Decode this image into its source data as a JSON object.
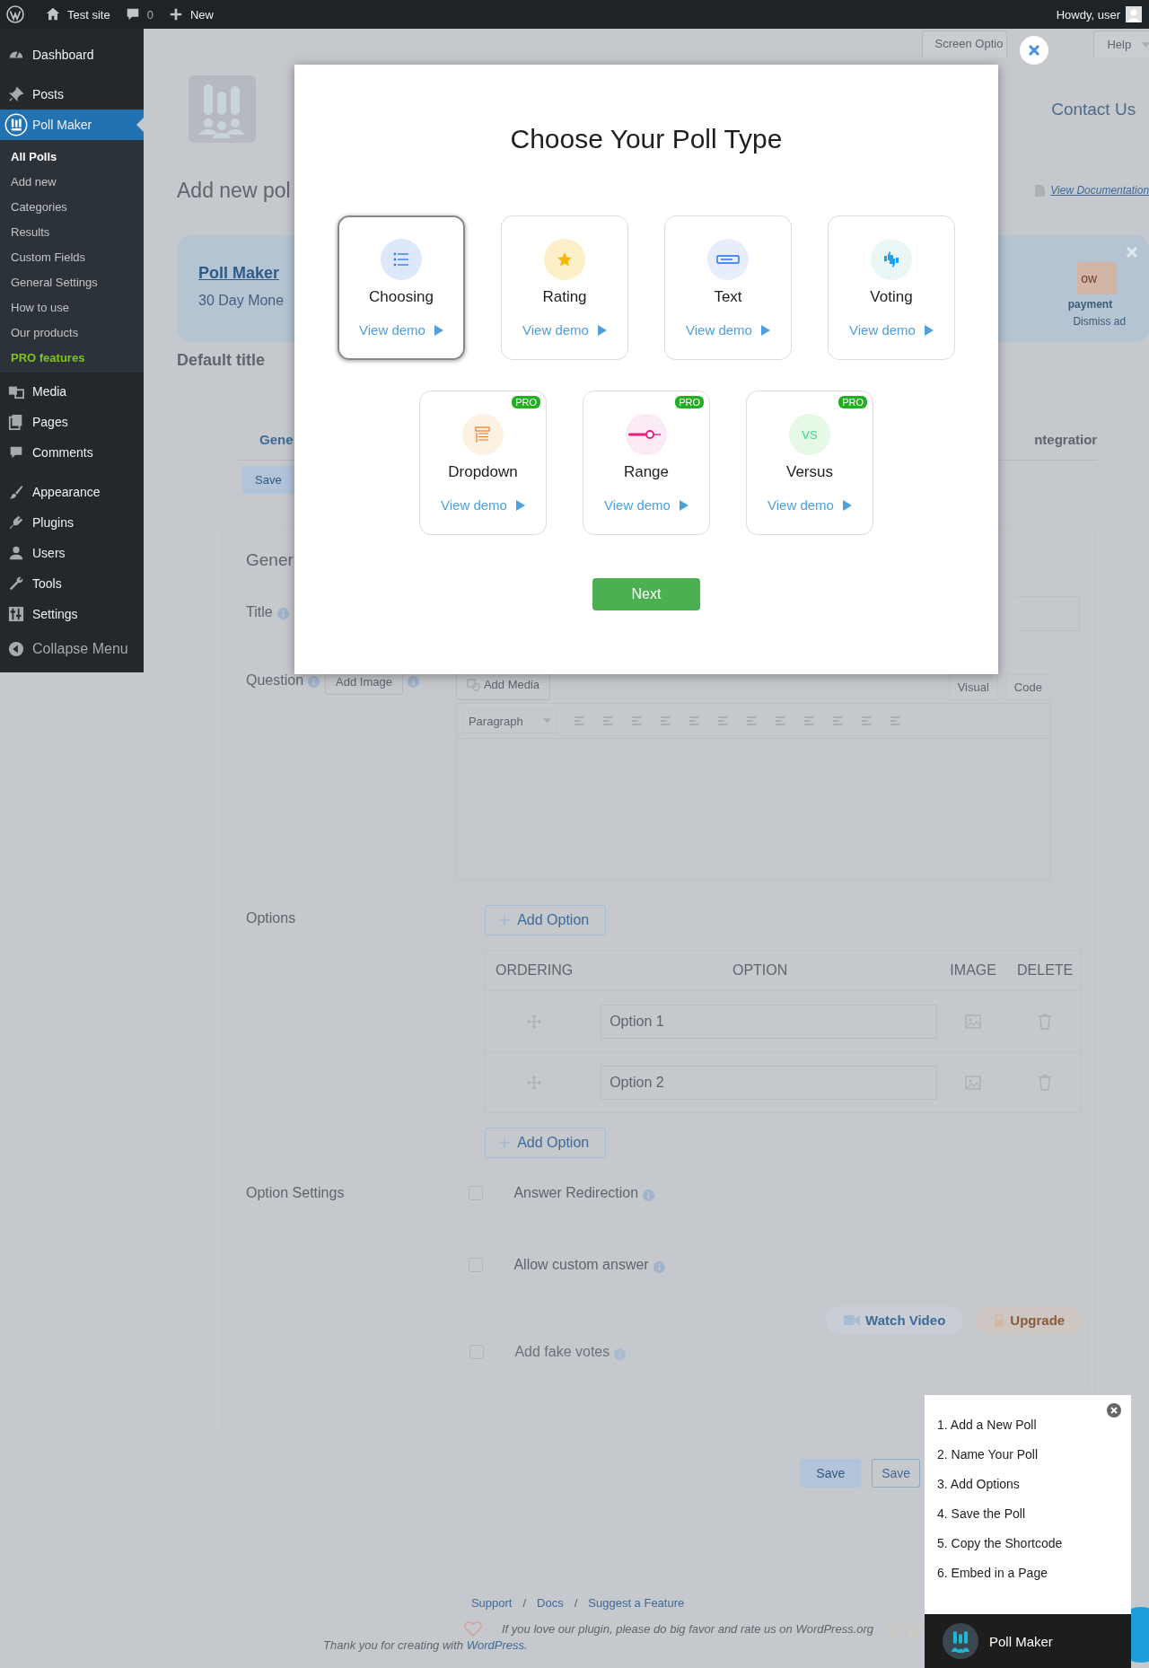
{
  "admin_bar": {
    "site": "Test site",
    "comments": "0",
    "new": "New",
    "greeting": "Howdy, user"
  },
  "sidebar": {
    "items": [
      {
        "label": "Dashboard",
        "selected": false
      },
      {
        "label": "Posts",
        "selected": false
      },
      {
        "label": "Poll Maker",
        "selected": true,
        "children": [
          {
            "label": "All Polls",
            "selected": true,
            "kind": "link"
          },
          {
            "label": "Add new",
            "selected": false,
            "kind": "link"
          },
          {
            "label": "Categories",
            "selected": false,
            "kind": "link"
          },
          {
            "label": "Results",
            "selected": false,
            "kind": "link"
          },
          {
            "label": "Custom Fields",
            "selected": false,
            "kind": "link"
          },
          {
            "label": "General Settings",
            "selected": false,
            "kind": "link"
          },
          {
            "label": "How to use",
            "selected": false,
            "kind": "link"
          },
          {
            "label": "Our products",
            "selected": false,
            "kind": "link"
          },
          {
            "label": "PRO features",
            "selected": false,
            "kind": "pro"
          }
        ]
      },
      {
        "label": "Media",
        "selected": false
      },
      {
        "label": "Pages",
        "selected": false
      },
      {
        "label": "Comments",
        "selected": false
      },
      {
        "label": "Appearance",
        "selected": false
      },
      {
        "label": "Plugins",
        "selected": false
      },
      {
        "label": "Users",
        "selected": false
      },
      {
        "label": "Tools",
        "selected": false
      },
      {
        "label": "Settings",
        "selected": false
      }
    ],
    "collapse": "Collapse Menu"
  },
  "page": {
    "screen_options": "Screen Optio",
    "help": "Help",
    "contact": "Contact Us",
    "heading": "Add new pol",
    "documentation": "View Documentation",
    "banner": {
      "title": "Poll Maker",
      "subtitle": "30 Day Mone",
      "button": "ow",
      "note": "payment",
      "dismiss": "Dismiss ad"
    },
    "poll_title": "Default title",
    "tabs": [
      {
        "label": "Gene",
        "selected": true
      },
      {
        "label": "ntegratior",
        "selected": false
      }
    ],
    "save_top": "Save",
    "section": "Gener",
    "title_label": "Title",
    "question_label": "Question",
    "add_image": "Add Image",
    "add_media": "Add Media",
    "editor_tabs": [
      "Visual",
      "Code"
    ],
    "format": "Paragraph",
    "options_label": "Options",
    "add_option": "Add Option",
    "columns": [
      "ORDERING",
      "OPTION",
      "IMAGE",
      "DELETE"
    ],
    "options": [
      {
        "placeholder": "Option 1"
      },
      {
        "placeholder": "Option 2"
      }
    ],
    "add_option_bottom": "Add Option",
    "settings_label": "Option Settings",
    "settings": [
      {
        "label": "Answer Redirection",
        "checked": false
      },
      {
        "label": "Allow custom answer",
        "checked": false
      }
    ],
    "watch_video": "Watch Video",
    "upgrade": "Upgrade",
    "fake_votes": {
      "label": "Add fake votes",
      "checked": false
    },
    "save": "Save",
    "save_2": "Save",
    "footer": {
      "links": [
        "Support",
        "Docs",
        "Suggest a Feature"
      ],
      "separators": [
        "/",
        "/"
      ],
      "rate": "If you love our plugin, please do big favor and rate us on WordPress.org",
      "thanks": "Thank you for creating with ",
      "thanks_link": "WordPress",
      "thanks_end": "."
    }
  },
  "modal": {
    "title": "Choose Your Poll Type",
    "types": [
      {
        "name": "Choosing",
        "demo": "View demo",
        "selected": true
      },
      {
        "name": "Rating",
        "demo": "View demo",
        "selected": false
      },
      {
        "name": "Text",
        "demo": "View demo",
        "selected": false
      },
      {
        "name": "Voting",
        "demo": "View demo",
        "selected": false
      },
      {
        "name": "Dropdown",
        "demo": "View demo",
        "selected": false,
        "badge": "PRO"
      },
      {
        "name": "Range",
        "demo": "View demo",
        "selected": false,
        "badge": "PRO"
      },
      {
        "name": "Versus",
        "demo": "View demo",
        "selected": false,
        "badge": "PRO",
        "icon_text": "VS"
      }
    ],
    "next": "Next"
  },
  "tour": {
    "steps": [
      "1. Add a New Poll",
      "2. Name Your Poll",
      "3. Add Options",
      "4. Save the Poll",
      "5. Copy the Shortcode",
      "6. Embed in a Page"
    ],
    "brand": "Poll Maker"
  }
}
